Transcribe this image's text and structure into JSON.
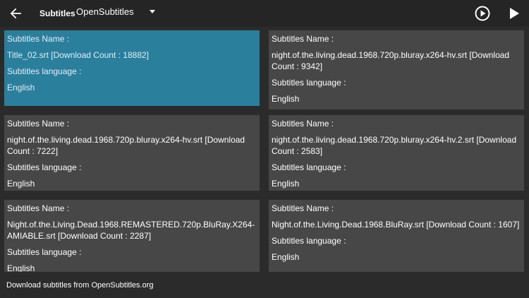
{
  "header": {
    "title": "Subtitles",
    "source_selected": "OpenSubtitles",
    "icons": [
      "arrow-left-icon",
      "chevron-down-icon",
      "play-circle-icon",
      "play-icon"
    ]
  },
  "colors": {
    "background": "#2b2b2b",
    "topbar": "#252525",
    "card": "#474747",
    "selected_card": "#2a7f9c"
  },
  "results": [
    {
      "name_label": "Subtitles Name :",
      "name": "Title_02.srt [Download Count : 18882]",
      "language_label": "Subtitles language :",
      "language": "English",
      "selected": true
    },
    {
      "name_label": "Subtitles Name :",
      "name": "night.of.the.living.dead.1968.720p.bluray.x264-hv.srt [Download Count : 9342]",
      "language_label": "Subtitles language :",
      "language": "English",
      "selected": false
    },
    {
      "name_label": "Subtitles Name :",
      "name": "night.of.the.living.dead.1968.720p.bluray.x264-hv.srt [Download Count : 7222]",
      "language_label": "Subtitles language :",
      "language": "English",
      "selected": false
    },
    {
      "name_label": "Subtitles Name :",
      "name": "night.of.the.living.dead.1968.720p.bluray.x264-hv.2.srt [Download Count : 2583]",
      "language_label": "Subtitles language :",
      "language": "English",
      "selected": false
    },
    {
      "name_label": "Subtitles Name :",
      "name": "Night.of.the.Living.Dead.1968.REMASTERED.720p.BluRay.X264-AMIABLE.srt [Download Count : 2287]",
      "language_label": "Subtitles language :",
      "language": "English",
      "selected": false
    },
    {
      "name_label": "Subtitles Name :",
      "name": "Night.of.the.Living.Dead.1968.BluRay.srt [Download Count : 1607]",
      "language_label": "Subtitles language :",
      "language": "English",
      "selected": false
    }
  ],
  "footer": {
    "text": "Download subtitles from OpenSubtitles.org"
  }
}
